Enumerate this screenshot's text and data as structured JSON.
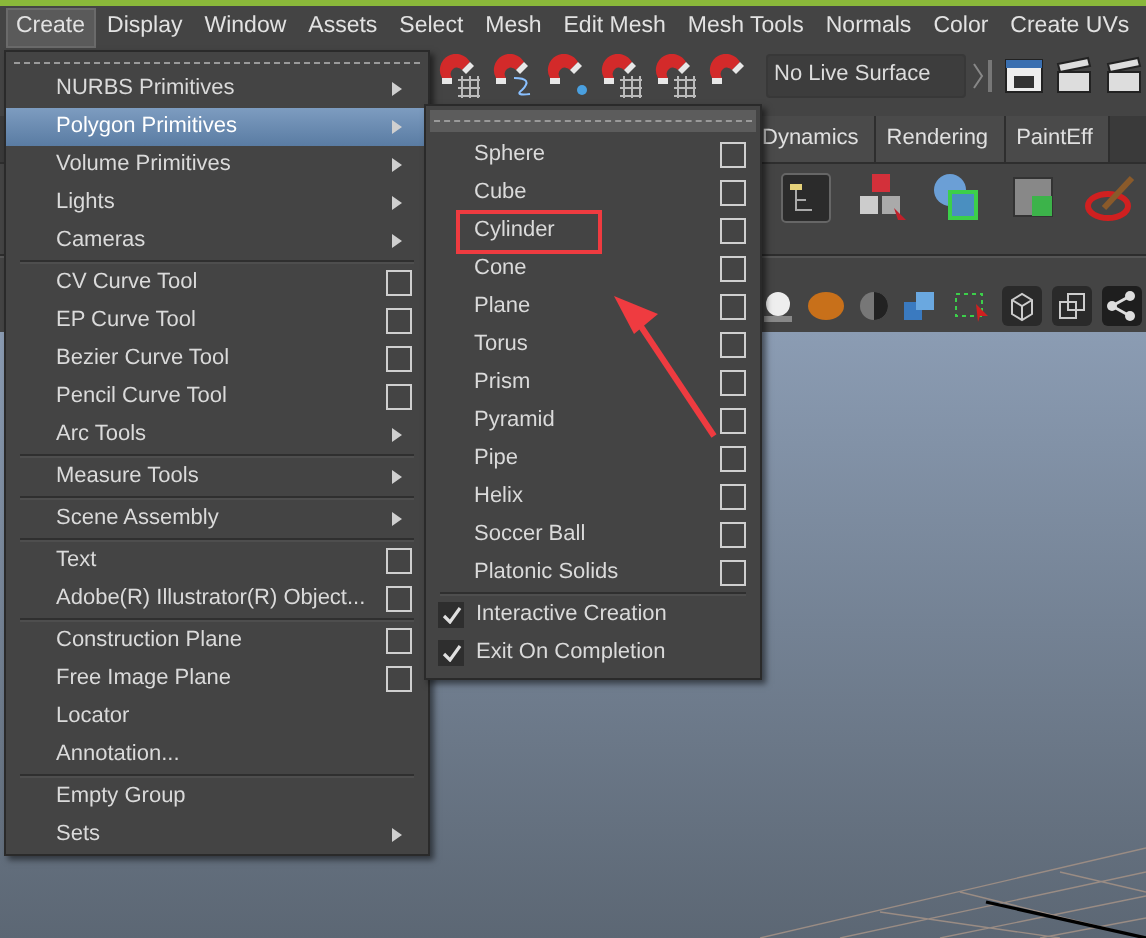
{
  "menu_bar": [
    {
      "label": "Create",
      "selected": true
    },
    {
      "label": "Display",
      "selected": false
    },
    {
      "label": "Window",
      "selected": false
    },
    {
      "label": "Assets",
      "selected": false
    },
    {
      "label": "Select",
      "selected": false
    },
    {
      "label": "Mesh",
      "selected": false
    },
    {
      "label": "Edit Mesh",
      "selected": false
    },
    {
      "label": "Mesh Tools",
      "selected": false
    },
    {
      "label": "Normals",
      "selected": false
    },
    {
      "label": "Color",
      "selected": false
    },
    {
      "label": "Create UVs",
      "selected": false
    }
  ],
  "status_line": {
    "live_surface": "No Live Surface"
  },
  "shelf_tabs": [
    {
      "label": "Dynamics"
    },
    {
      "label": "Rendering"
    },
    {
      "label": "PaintEff"
    }
  ],
  "create_menu": {
    "groups": [
      [
        {
          "label": "NURBS Primitives",
          "kind": "submenu",
          "selected": false
        },
        {
          "label": "Polygon Primitives",
          "kind": "submenu",
          "selected": true
        },
        {
          "label": "Volume Primitives",
          "kind": "submenu",
          "selected": false
        },
        {
          "label": "Lights",
          "kind": "submenu",
          "selected": false
        },
        {
          "label": "Cameras",
          "kind": "submenu",
          "selected": false
        }
      ],
      [
        {
          "label": "CV Curve Tool",
          "kind": "option",
          "selected": false
        },
        {
          "label": "EP Curve Tool",
          "kind": "option",
          "selected": false
        },
        {
          "label": "Bezier Curve Tool",
          "kind": "option",
          "selected": false
        },
        {
          "label": "Pencil Curve Tool",
          "kind": "option",
          "selected": false
        },
        {
          "label": "Arc Tools",
          "kind": "submenu",
          "selected": false
        }
      ],
      [
        {
          "label": "Measure Tools",
          "kind": "submenu",
          "selected": false
        }
      ],
      [
        {
          "label": "Scene Assembly",
          "kind": "submenu",
          "selected": false
        }
      ],
      [
        {
          "label": "Text",
          "kind": "option",
          "selected": false
        },
        {
          "label": "Adobe(R) Illustrator(R) Object...",
          "kind": "option",
          "selected": false
        }
      ],
      [
        {
          "label": "Construction Plane",
          "kind": "option",
          "selected": false
        },
        {
          "label": "Free Image Plane",
          "kind": "option",
          "selected": false
        },
        {
          "label": "Locator",
          "kind": "plain",
          "selected": false
        },
        {
          "label": "Annotation...",
          "kind": "plain",
          "selected": false
        }
      ],
      [
        {
          "label": "Empty Group",
          "kind": "plain",
          "selected": false
        },
        {
          "label": "Sets",
          "kind": "submenu",
          "selected": false
        }
      ]
    ]
  },
  "polygon_menu": {
    "groups": [
      [
        {
          "label": "Sphere",
          "kind": "option",
          "boxed": false
        },
        {
          "label": "Cube",
          "kind": "option",
          "boxed": false
        },
        {
          "label": "Cylinder",
          "kind": "option",
          "boxed": true
        },
        {
          "label": "Cone",
          "kind": "option",
          "boxed": false
        },
        {
          "label": "Plane",
          "kind": "option",
          "boxed": false
        },
        {
          "label": "Torus",
          "kind": "option",
          "boxed": false
        },
        {
          "label": "Prism",
          "kind": "option",
          "boxed": false
        },
        {
          "label": "Pyramid",
          "kind": "option",
          "boxed": false
        },
        {
          "label": "Pipe",
          "kind": "option",
          "boxed": false
        },
        {
          "label": "Helix",
          "kind": "option",
          "boxed": false
        },
        {
          "label": "Soccer Ball",
          "kind": "option",
          "boxed": false
        },
        {
          "label": "Platonic Solids",
          "kind": "option",
          "boxed": false
        }
      ],
      [
        {
          "label": "Interactive Creation",
          "kind": "check",
          "checked": true,
          "boxed": false
        },
        {
          "label": "Exit On Completion",
          "kind": "check",
          "checked": true,
          "boxed": false
        }
      ]
    ]
  }
}
